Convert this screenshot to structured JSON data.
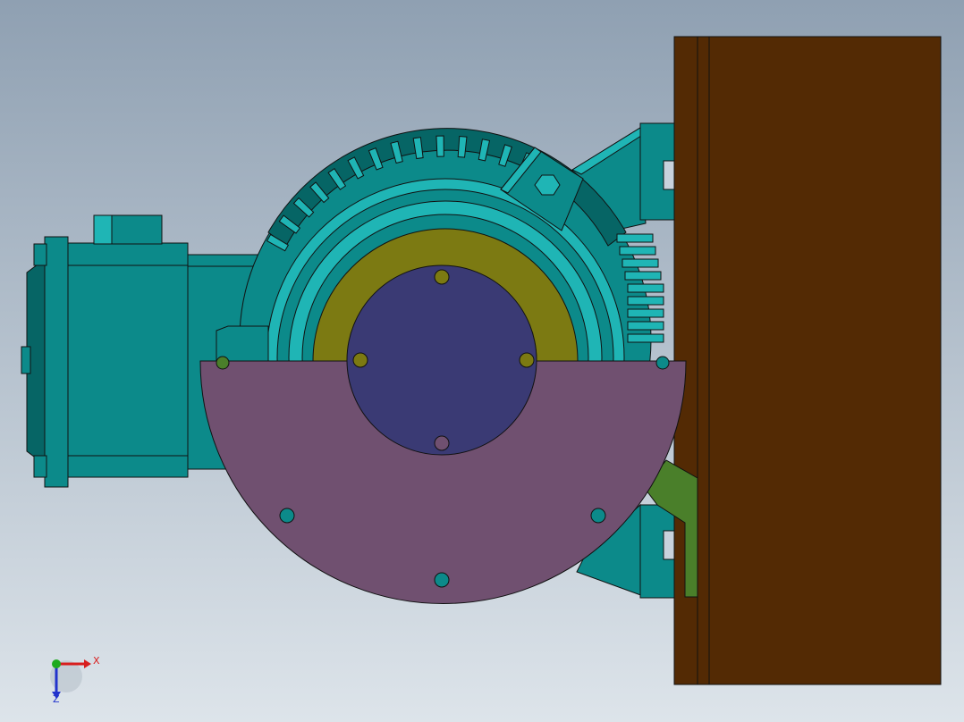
{
  "viewport": {
    "background_top": "#8fa0b2",
    "background_bottom": "#dde4ea"
  },
  "colors": {
    "motor_teal": "#0c8a8a",
    "motor_teal_light": "#1fb5b5",
    "motor_teal_dark": "#066565",
    "guard_olive": "#7c7a12",
    "shaft_flange_blue": "#3a3a74",
    "cover_plate_mauve": "#705070",
    "panel_brown": "#532a04",
    "bracket_green": "#4a7f2a",
    "outline": "#111111"
  },
  "axis_triad": {
    "x_label": "X",
    "z_label": "Z",
    "x_color": "#d81e1e",
    "z_color": "#2233cc",
    "y_color": "#1eaa1e"
  }
}
